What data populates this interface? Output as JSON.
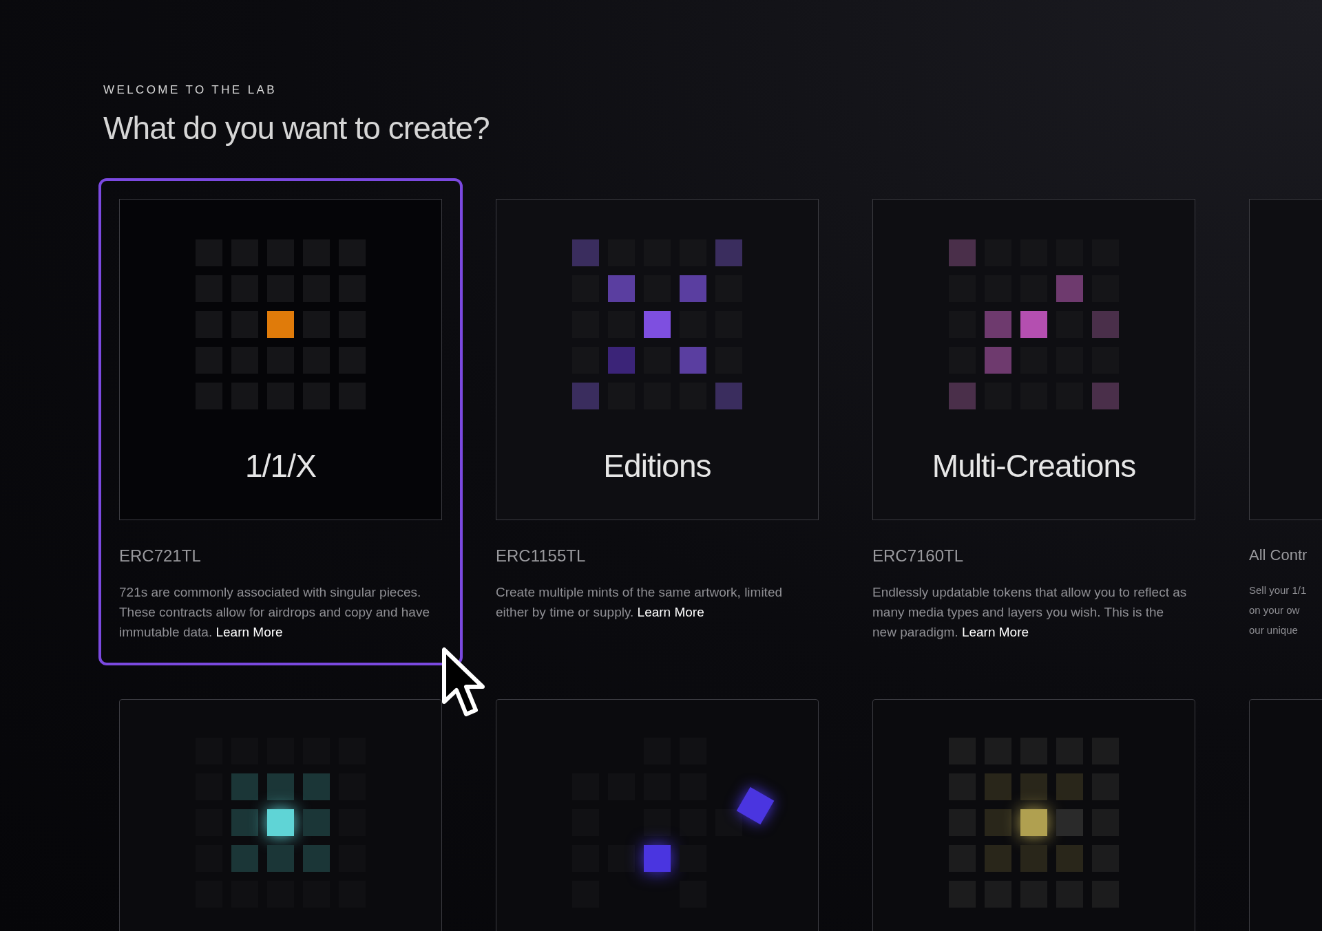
{
  "eyebrow": "WELCOME TO THE LAB",
  "heading": "What do you want to create?",
  "cards": [
    {
      "title": "1/1/X",
      "code": "ERC721TL",
      "description": "721s are commonly associated with singular pieces. These contracts allow for airdrops and copy and have immutable data.",
      "link": "Learn More",
      "kind": "single",
      "selected": true
    },
    {
      "title": "Editions",
      "code": "ERC1155TL",
      "description": "Create multiple mints of the same artwork, limited either by time or supply.",
      "link": "Learn More",
      "kind": "editions",
      "selected": false
    },
    {
      "title": "Multi-Creations",
      "code": "ERC7160TL",
      "description": "Endlessly updatable tokens that allow you to reflect as many media types and layers you wish. This is the new paradigm.",
      "link": "Learn More",
      "kind": "multi",
      "selected": false
    }
  ],
  "partial_card": {
    "code": "All Contr",
    "lines": [
      "Sell your 1/1",
      "on your ow",
      "our unique"
    ]
  },
  "lower_cards": [
    {
      "kind": "teal"
    },
    {
      "kind": "scatter"
    },
    {
      "kind": "gold"
    },
    {
      "kind": "blank"
    }
  ]
}
